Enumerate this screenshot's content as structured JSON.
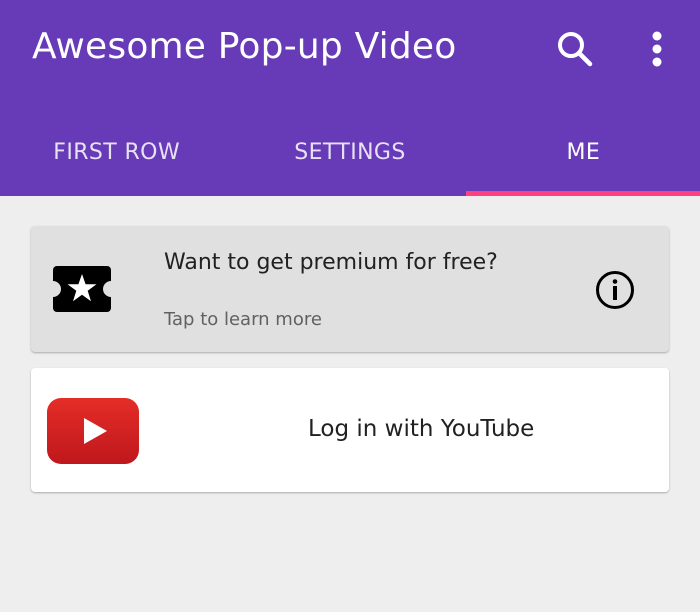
{
  "app": {
    "title": "Awesome Pop-up Video",
    "colors": {
      "primary": "#673ab7",
      "accent": "#ff4081",
      "background": "#eeeeee"
    },
    "actions": [
      {
        "icon": "search-icon"
      },
      {
        "icon": "more-vert-icon"
      }
    ]
  },
  "tabs": [
    {
      "label": "FIRST ROW",
      "active": false
    },
    {
      "label": "SETTINGS",
      "active": false
    },
    {
      "label": "ME",
      "active": true
    }
  ],
  "cards": {
    "premium": {
      "icon": "ticket-star-icon",
      "title": "Want to get premium for free?",
      "subtitle": "Tap to learn more",
      "action_icon": "info-icon"
    },
    "youtube": {
      "icon": "youtube-logo-icon",
      "label": "Log in with YouTube",
      "brand_color": "#d32420"
    }
  }
}
